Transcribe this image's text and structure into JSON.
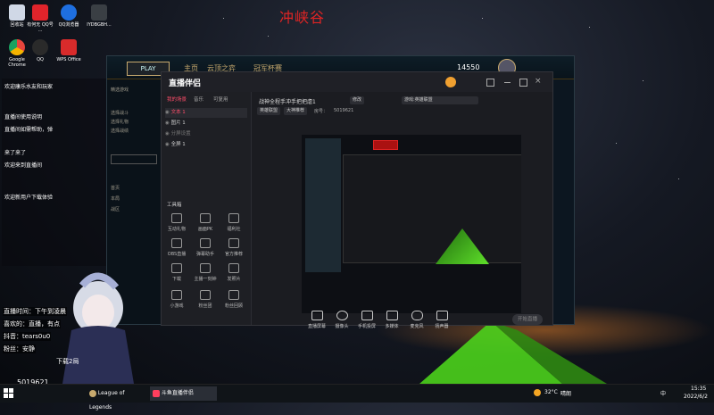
{
  "top_title": "冲峡谷",
  "desktop_icons": [
    {
      "label": "回收站",
      "color": "#d0d8e6"
    },
    {
      "label": "有何无 QQ号 ...",
      "color": "#e0242b"
    },
    {
      "label": "QQ浏览器",
      "color": "#1e6fe0"
    },
    {
      "label": "IYDBGBH...",
      "color": "#3a3f44"
    },
    {
      "label": "Google Chrome",
      "color": "#e8453c"
    },
    {
      "label": "QQ",
      "color": "#2a2a2a"
    },
    {
      "label": "WPS Office",
      "color": "#d92b2b"
    }
  ],
  "left_overlay_lines": [
    "欢迎康乐水友和玩家",
    "直播间使用说明",
    "直播间如需帮助，弹",
    "来了来了",
    "欢迎来到直播间",
    "欢迎新用户下载体验"
  ],
  "lol": {
    "play_label": "PLAY",
    "tabs": [
      "主页",
      "云顶之弈",
      "冠军杯赛"
    ],
    "currency": "14550",
    "side_items": [
      "精选游戏",
      "选择战斗",
      "选择礼物",
      "选择战绩",
      "选择礼物",
      "首页",
      "本局",
      "战区"
    ]
  },
  "app": {
    "logo": "直播伴侣",
    "left_tabs": [
      "我的场景",
      "音乐",
      "可复用"
    ],
    "scenes": [
      "文本 1",
      "图片 1",
      "分屏设置",
      "全屏 1"
    ],
    "tools_header": "工具箱",
    "tools": [
      {
        "label": "互动礼物",
        "icon": "gift-icon"
      },
      {
        "label": "画面PK",
        "icon": "pk-icon"
      },
      {
        "label": "福利社",
        "icon": "welfare-icon"
      },
      {
        "label": "OBS直播",
        "icon": "obs-icon"
      },
      {
        "label": "弹幕助手",
        "icon": "danmaku-icon"
      },
      {
        "label": "官方推荐",
        "icon": "recommend-icon"
      },
      {
        "label": "下载",
        "icon": "download-icon"
      },
      {
        "label": "主播一刻钟",
        "icon": "clock-icon"
      },
      {
        "label": "发照片",
        "icon": "photo-icon"
      },
      {
        "label": "小游戏",
        "icon": "game-icon"
      },
      {
        "label": "粉丝团",
        "icon": "fans-icon"
      },
      {
        "label": "粉丝回顾",
        "icon": "review-icon"
      }
    ],
    "title_line": "战神全程手冲手把把虐1",
    "tag1": "修改",
    "tag2": "游戏:英雄联盟",
    "room_label": "房号：",
    "room_id": "5019621",
    "chip1": "英雄联盟",
    "chip2": "大神推荐",
    "chip3": "关闭",
    "bottom_tools": [
      {
        "label": "直播屏幕",
        "icon": "screen-icon"
      },
      {
        "label": "摄像头",
        "icon": "camera-icon"
      },
      {
        "label": "手机投屏",
        "icon": "phone-icon"
      },
      {
        "label": "多媒体",
        "icon": "media-icon"
      },
      {
        "label": "麦克风",
        "icon": "mic-icon"
      },
      {
        "label": "扬声器",
        "icon": "speaker-icon"
      }
    ],
    "start_live": "开始直播",
    "status": {
      "label1": "码率",
      "label2": "CPU",
      "label3": "内存",
      "label4": "帧率"
    }
  },
  "overlay": {
    "line1": "直播时间：下午到凌晨",
    "line2": "喜欢的：直播，有点",
    "line3": "抖音：tears0u0",
    "line4": "粉丝：安静",
    "id": "5019621",
    "watermark": "下载2局"
  },
  "taskbar": {
    "items": [
      "League of Legends",
      "斗鱼直播伴侣"
    ],
    "temp": "32°C",
    "weather": "晴朗",
    "time": "15:35",
    "date": "2022/6/2",
    "lang": "中"
  }
}
